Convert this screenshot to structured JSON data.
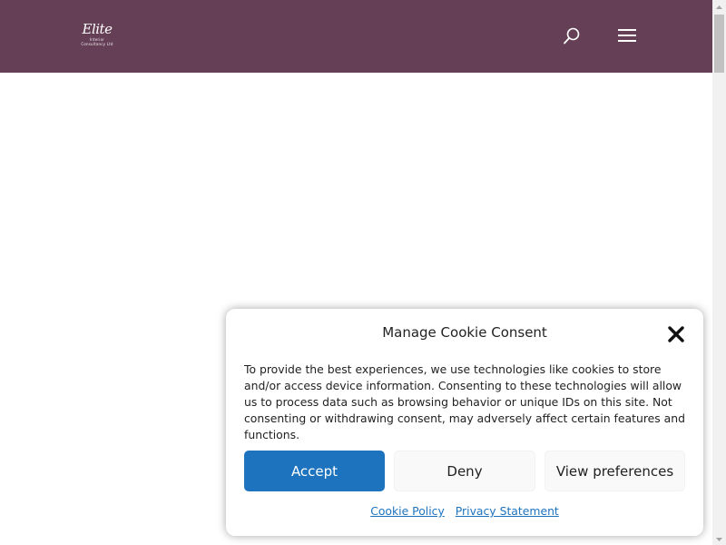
{
  "header": {
    "background": "#653f55",
    "logo": {
      "script_text": "Elite",
      "line1": "Interior",
      "line2": "Consultancy Ltd"
    },
    "search_icon": "search-icon",
    "menu_icon": "hamburger-menu-icon"
  },
  "cookie_consent": {
    "title": "Manage Cookie Consent",
    "message": "To provide the best experiences, we use technologies like cookies to store and/or access device information. Consenting to these technologies will allow us to process data such as browsing behavior or unique IDs on this site. Not consenting or withdrawing consent, may adversely affect certain features and functions.",
    "buttons": {
      "accept": "Accept",
      "deny": "Deny",
      "view_preferences": "View preferences"
    },
    "links": {
      "cookie_policy": "Cookie Policy",
      "privacy_statement": "Privacy Statement"
    },
    "close_icon": "close-icon",
    "accent_color": "#1e73be"
  }
}
